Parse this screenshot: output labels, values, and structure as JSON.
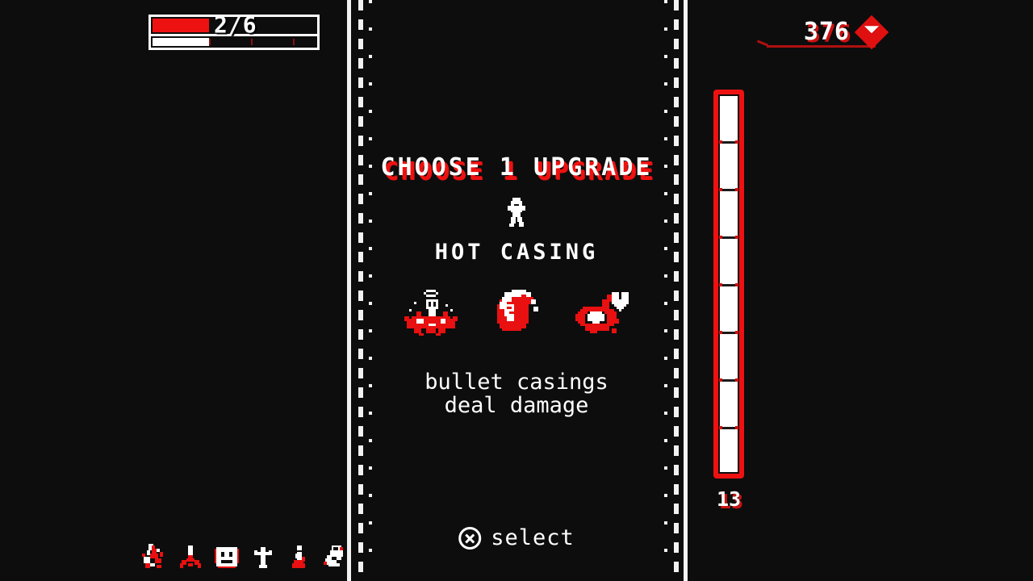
{
  "hud": {
    "health": {
      "name": "health-bar",
      "current": 2,
      "max": 6,
      "display": "2/6",
      "fill_color": "#ee1111",
      "secondary_fill_color": "#ffffff",
      "border_color": "#ffffff"
    },
    "score": {
      "name": "score-counter",
      "value": "376",
      "icon": "diamond-gem-icon",
      "accent_color": "#e01010"
    },
    "ammo_meter": {
      "name": "ammo-meter",
      "count": "13",
      "segments": 8,
      "fill_color": "#ffffff",
      "border_color": "#ee1111"
    },
    "item_tray": {
      "name": "item-tray",
      "items": [
        {
          "icon": "blood-splat-icon",
          "label": "blood splat"
        },
        {
          "icon": "down-drip-icon",
          "label": "drip"
        },
        {
          "icon": "smiley-face-icon",
          "label": "smiley"
        },
        {
          "icon": "cross-grave-icon",
          "label": "grave cross"
        },
        {
          "icon": "kneeling-figure-icon",
          "label": "kneeling figure"
        },
        {
          "icon": "ghost-figure-icon",
          "label": "ghost"
        }
      ]
    }
  },
  "upgrade_panel": {
    "title": "CHOOSE 1 UPGRADE",
    "hero_icon": "player-sprite-icon",
    "upgrade_name": "HOT CASING",
    "effect_icons": [
      {
        "icon": "explosion-splat-icon",
        "label": "explosion"
      },
      {
        "icon": "spinning-casing-icon",
        "label": "bullet casing"
      },
      {
        "icon": "red-slash-heart-icon",
        "label": "damage slash"
      }
    ],
    "description_line_1": "bullet casings",
    "description_line_2": "deal damage"
  },
  "prompt": {
    "button_glyph": "cross-button-icon",
    "label": "select"
  },
  "theme": {
    "background": "#0d0d0d",
    "primary": "#ffffff",
    "accent_red": "#ee1111",
    "shadow_red": "#cc1111"
  }
}
